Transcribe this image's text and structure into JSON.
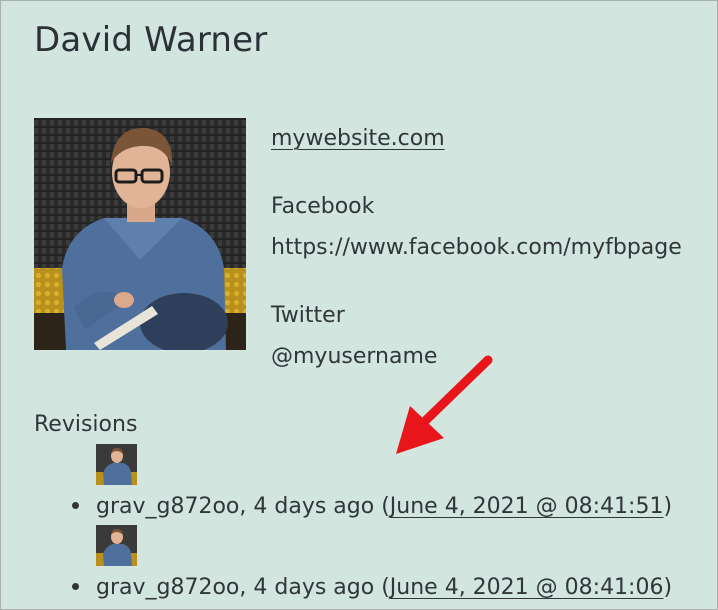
{
  "profile": {
    "name": "David Warner",
    "website": "mywebsite.com",
    "facebook_label": "Facebook",
    "facebook_url": "https://www.facebook.com/myfbpage",
    "twitter_label": "Twitter",
    "twitter_handle": "@myusername"
  },
  "revisions": {
    "title": "Revisions",
    "items": [
      {
        "author": "grav_g872oo",
        "relative": "4 days ago",
        "open": " (",
        "date_link": "June 4, 2021 @ 08:41:51",
        "close": ")"
      },
      {
        "author": "grav_g872oo",
        "relative": "4 days ago",
        "open": " (",
        "date_link": "June 4, 2021 @ 08:41:06",
        "close": ")"
      }
    ]
  },
  "colors": {
    "background": "#d3e5df",
    "text": "#30363a",
    "arrow": "#e8161b"
  },
  "icons": {
    "avatar": "person-photo",
    "annotation": "red-arrow-icon"
  }
}
